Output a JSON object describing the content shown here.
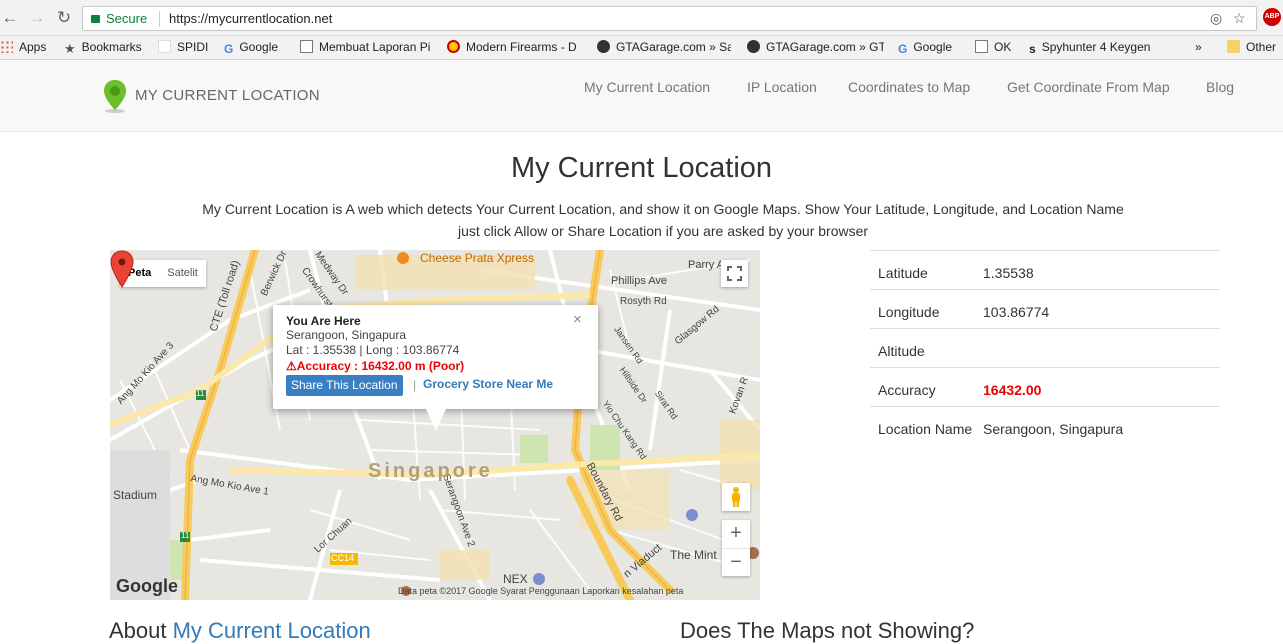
{
  "browser": {
    "secure_label": "Secure",
    "url": "https://mycurrentlocation.net",
    "extension_badge": "ABP"
  },
  "bookmarks": [
    {
      "label": "Apps",
      "icon": "apps-grid-icon"
    },
    {
      "label": "Bookmarks",
      "icon": "star-icon"
    },
    {
      "label": "SPIDI",
      "icon": "page-icon"
    },
    {
      "label": "Google",
      "icon": "google-icon"
    },
    {
      "label": "Membuat Laporan Pi",
      "icon": "document-icon"
    },
    {
      "label": "Modern Firearms - D",
      "icon": "target-icon"
    },
    {
      "label": "GTAGarage.com » Sa",
      "icon": "gtagarage-icon"
    },
    {
      "label": "GTAGarage.com » GT",
      "icon": "gtagarage-icon"
    },
    {
      "label": "Google",
      "icon": "google-icon"
    },
    {
      "label": "OK",
      "icon": "document-icon"
    },
    {
      "label": "Spyhunter 4 Keygen",
      "icon": "s-icon"
    },
    {
      "label": "»",
      "icon": "overflow-icon"
    },
    {
      "label": "Other",
      "icon": "folder-icon"
    }
  ],
  "site": {
    "logo_text": "MY CURRENT LOCATION",
    "nav": [
      "My Current Location",
      "IP Location",
      "Coordinates to Map",
      "Get Coordinate From Map",
      "Blog"
    ]
  },
  "main": {
    "title": "My Current Location",
    "intro_line1": "My Current Location is A web which detects Your Current Location, and show it on Google Maps. Show Your Latitude, Longitude, and Location Name",
    "intro_line2": "just click Allow or Share Location if you are asked by your browser"
  },
  "map": {
    "type_buttons": [
      "Peta",
      "Satelit"
    ],
    "active_type": "Peta",
    "city_label": "Singapore",
    "labels": {
      "cheese_prata": "Cheese Prata Xpress",
      "phillips": "Phillips Ave",
      "parry": "Parry A",
      "rosyth": "Rosyth Rd",
      "glasgow": "Glasgow Rd",
      "cte": "CTE (Toll road)",
      "berwick": "Berwick Dr",
      "medway": "Medway Dr",
      "crowhurst": "Crowhurst",
      "ang_mo_kio_ave3": "Ang Mo Kio Ave 3",
      "ang_mo_kio_ave1": "Ang Mo Kio Ave 1",
      "stadium": "Stadium",
      "boundary": "Boundary Rd",
      "serangoon_ave2": "Serangoon Ave 2",
      "lor_chuan": "Lor Chuan",
      "nex": "NEX",
      "the_mint": "The Mint",
      "cc14": "CC14",
      "jansen": "Jansen Rd",
      "hillside": "Hillside Dr",
      "sirat": "Sirat Rd",
      "lor_chuan_kang": "Yio Chu Kang Rd",
      "kovan": "Kovan R",
      "viaduct": "n Viaduct",
      "route11a": "11",
      "route11b": "11"
    },
    "google_logo": "Google",
    "attribution": "Data peta ©2017 Google     Syarat Penggunaan     Laporkan kesalahan peta",
    "zoom_in": "+",
    "zoom_out": "−",
    "info_window": {
      "title": "You Are Here",
      "place": "Serangoon, Singapura",
      "coords": "Lat : 1.35538 | Long : 103.86774",
      "accuracy": "Accuracy : 16432.00 m (Poor)",
      "share_button": "Share This Location",
      "separator": "|",
      "grocery_link": "Grocery Store Near Me",
      "close": "×"
    }
  },
  "location_table": [
    {
      "key": "Latitude",
      "value": "1.35538"
    },
    {
      "key": "Longitude",
      "value": "103.86774"
    },
    {
      "key": "Altitude",
      "value": ""
    },
    {
      "key": "Accuracy",
      "value": "16432.00"
    },
    {
      "key": "Location Name",
      "value": "Serangoon, Singapura"
    }
  ],
  "sections": {
    "about_prefix": "About ",
    "about_highlight": "My Current Location",
    "maps_not_showing": "Does The Maps not Showing?"
  },
  "colors": {
    "accent": "#337ab7",
    "accuracy_red": "#e00000",
    "secure_green": "#0b8043",
    "road_yellow": "#f9c95a"
  }
}
